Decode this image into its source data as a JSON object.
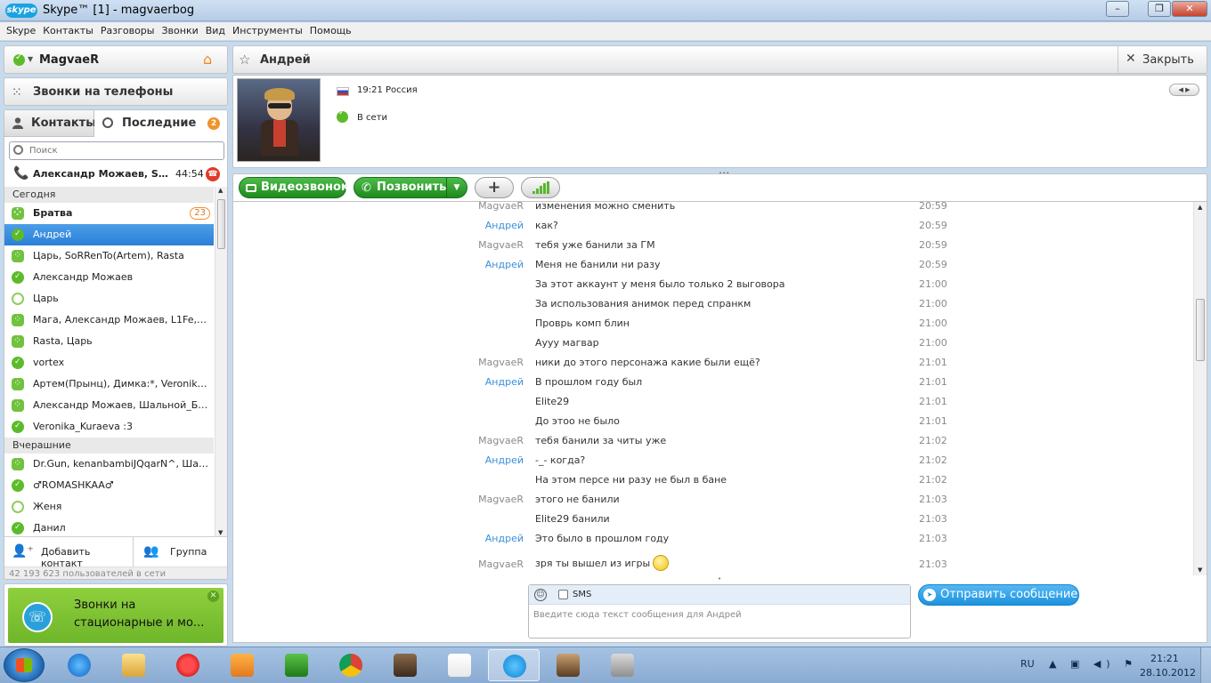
{
  "window": {
    "logo": "skype",
    "title": "Skype™ [1] - magvaerbog",
    "controls": [
      "–",
      "❐",
      "✕"
    ]
  },
  "menu": [
    "Skype",
    "Контакты",
    "Разговоры",
    "Звонки",
    "Вид",
    "Инструменты",
    "Помощь"
  ],
  "sidebar": {
    "username": "MagvaeR",
    "phones_label": "Звонки на телефоны",
    "tab_contacts": "Контакты",
    "tab_recent": "Последние",
    "recent_badge": "2",
    "search_placeholder": "Поиск",
    "active_call": {
      "name": "Александр Можаев, SO...",
      "duration": "44:54"
    },
    "section_today": "Сегодня",
    "section_yesterday": "Вчерашние",
    "contacts_today": [
      {
        "name": "Братва",
        "icon": "group",
        "bold": true,
        "badge": "23"
      },
      {
        "name": "Андрей",
        "icon": "online",
        "selected": true
      },
      {
        "name": "Царь, SoRRenTo(Artem), Rasta",
        "icon": "group"
      },
      {
        "name": "Александр Можаев",
        "icon": "online"
      },
      {
        "name": "Царь",
        "icon": "offline"
      },
      {
        "name": "Мага, Александр Можаев, L1Fe, ...",
        "icon": "group"
      },
      {
        "name": "Rasta, Царь",
        "icon": "group"
      },
      {
        "name": "vortex",
        "icon": "online"
      },
      {
        "name": "Артем(Прынц), Димка:*, Veronika_Ku...",
        "icon": "group"
      },
      {
        "name": "Александр Можаев, Шальной_Батон...",
        "icon": "group"
      },
      {
        "name": "Veronika_Kuraeva :3",
        "icon": "online"
      }
    ],
    "contacts_yesterday": [
      {
        "name": "Dr.Gun, kenanbambiJQqarN^, Шальн...",
        "icon": "group"
      },
      {
        "name": "♂ROMASHKAA♂",
        "icon": "online"
      },
      {
        "name": "Женя",
        "icon": "offline"
      },
      {
        "name": "Данил",
        "icon": "online"
      }
    ],
    "add_contact_label": "Добавить контакт",
    "group_label": "Группа",
    "users_online": "42 193 623 пользователей в сети",
    "promo_text": "Звонки на стационарные и мо..."
  },
  "chat": {
    "name": "Андрей",
    "close_label": "Закрыть",
    "local_time": "19:21 Россия",
    "status": "В сети",
    "video_label": "Видеозвонок",
    "call_label": "Позвонить",
    "add_label": "+",
    "messages": [
      {
        "from": "MagvaeR",
        "me": true,
        "text": "изменения можно сменить",
        "time": "20:59"
      },
      {
        "from": "Андрей",
        "me": false,
        "text": "как?",
        "time": "20:59"
      },
      {
        "from": "MagvaeR",
        "me": true,
        "text": "тебя уже банили за ГМ",
        "time": "20:59"
      },
      {
        "from": "Андрей",
        "me": false,
        "text": "Меня не банили ни разу",
        "time": "20:59"
      },
      {
        "from": "",
        "me": false,
        "text": "За этот аккаунт у меня было только 2 выговора",
        "time": "21:00"
      },
      {
        "from": "",
        "me": false,
        "text": "За использования анимок перед спранкм",
        "time": "21:00"
      },
      {
        "from": "",
        "me": false,
        "text": "Проврь комп блин",
        "time": "21:00"
      },
      {
        "from": "",
        "me": false,
        "text": "Аууу магвар",
        "time": "21:00"
      },
      {
        "from": "MagvaeR",
        "me": true,
        "text": "ники до этого персонажа какие были ещё?",
        "time": "21:01"
      },
      {
        "from": "Андрей",
        "me": false,
        "text": "В прошлом году был",
        "time": "21:01"
      },
      {
        "from": "",
        "me": false,
        "text": "Elite29",
        "time": "21:01"
      },
      {
        "from": "",
        "me": false,
        "text": "До этоо не было",
        "time": "21:01"
      },
      {
        "from": "MagvaeR",
        "me": true,
        "text": "тебя банили за читы уже",
        "time": "21:02"
      },
      {
        "from": "Андрей",
        "me": false,
        "text": "-_- когда?",
        "time": "21:02"
      },
      {
        "from": "",
        "me": false,
        "text": "На этом персе ни разу не был в бане",
        "time": "21:02"
      },
      {
        "from": "MagvaeR",
        "me": true,
        "text": "этого не банили",
        "time": "21:03"
      },
      {
        "from": "",
        "me": false,
        "text": "Elite29 банили",
        "time": "21:03"
      },
      {
        "from": "Андрей",
        "me": false,
        "text": "Это было в прошлом году",
        "time": "21:03"
      },
      {
        "from": "MagvaeR",
        "me": true,
        "text": "зря ты вышел из игры",
        "time": "21:03",
        "emoji": true
      }
    ],
    "sms_label": "SMS",
    "input_placeholder": "Введите сюда текст сообщения для Андрей",
    "send_label": "Отправить сообщение"
  },
  "taskbar": {
    "apps": [
      "internet-explorer",
      "file-explorer",
      "opera",
      "media-player",
      "app-green",
      "chrome",
      "game-avatar",
      "pdf-reader",
      "skype",
      "game-avatar-2",
      "monitor-app"
    ],
    "active_app": "skype",
    "lang": "RU",
    "time": "21:21",
    "date": "28.10.2012"
  }
}
